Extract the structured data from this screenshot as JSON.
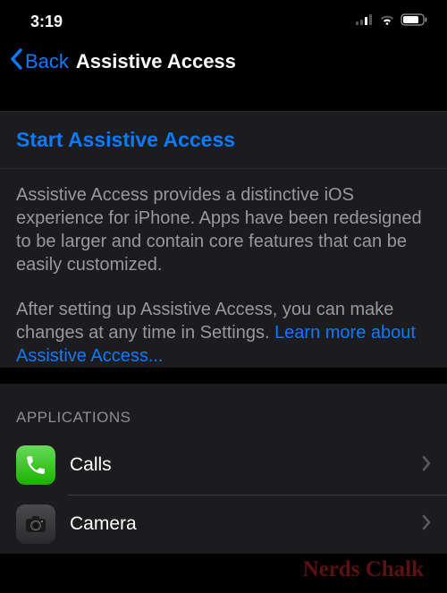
{
  "statusBar": {
    "time": "3:19"
  },
  "nav": {
    "backLabel": "Back",
    "title": "Assistive Access"
  },
  "startRow": {
    "label": "Start Assistive Access"
  },
  "description": {
    "para1": "Assistive Access provides a distinctive iOS experience for iPhone. Apps have been redesigned to be larger and contain core features that can be easily customized.",
    "para2_part1": "After setting up Assistive Access, you can make changes at any time in Settings. ",
    "learnMore": "Learn more about Assistive Access..."
  },
  "sectionHeader": "APPLICATIONS",
  "apps": {
    "0": {
      "label": "Calls"
    },
    "1": {
      "label": "Camera"
    }
  },
  "watermark": "Nerds Chalk"
}
